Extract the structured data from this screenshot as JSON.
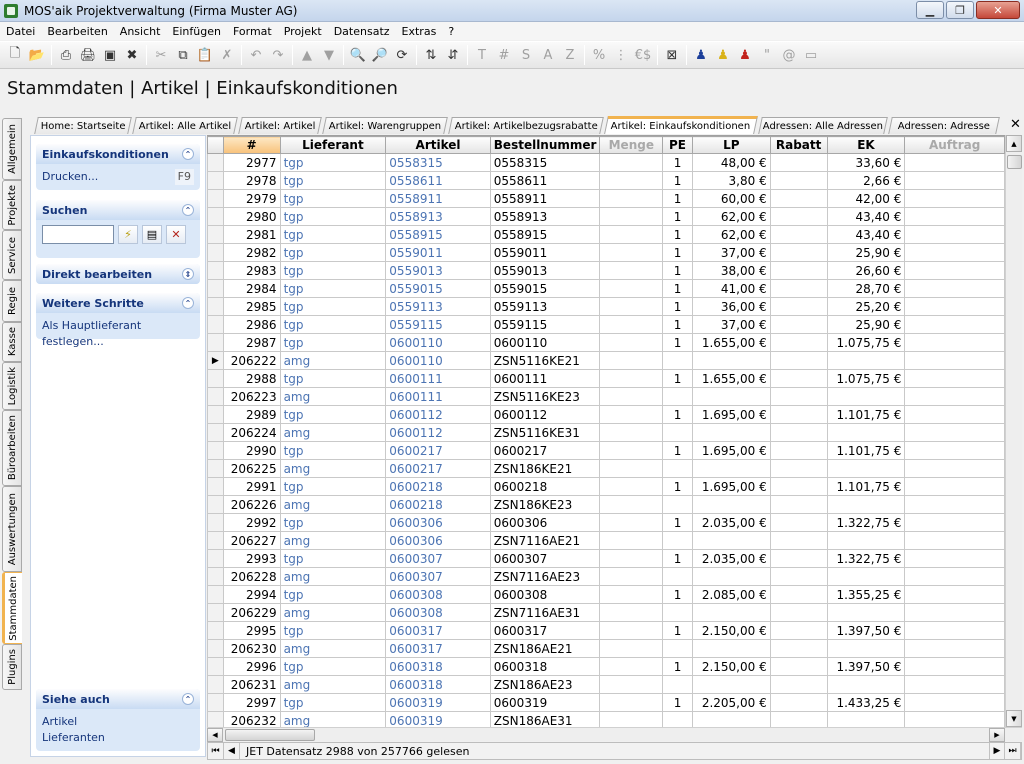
{
  "window": {
    "title": "MOS'aik Projektverwaltung (Firma Muster AG)"
  },
  "menu": [
    "Datei",
    "Bearbeiten",
    "Ansicht",
    "Einfügen",
    "Format",
    "Projekt",
    "Datensatz",
    "Extras",
    "?"
  ],
  "toolbar": {
    "letter_buttons": [
      "T",
      "#",
      "S",
      "A",
      "Z",
      "%",
      "€$",
      "\""
    ]
  },
  "page_title": "Stammdaten | Artikel | Einkaufskonditionen",
  "side_tabs": [
    "Allgemein",
    "Projekte",
    "Service",
    "Regie",
    "Kasse",
    "Logistik",
    "Büroarbeiten",
    "Auswertungen",
    "Stammdaten",
    "Plugins"
  ],
  "active_side_tab": "Stammdaten",
  "tabs": [
    "Home: Startseite",
    "Artikel: Alle Artikel",
    "Artikel: Artikel",
    "Artikel: Warengruppen",
    "Artikel: Artikelbezugsrabatte",
    "Artikel: Einkaufskonditionen",
    "Adressen: Alle Adressen",
    "Adressen: Adresse"
  ],
  "active_tab": "Artikel: Einkaufskonditionen",
  "left_panel": {
    "einkauf": {
      "title": "Einkaufskonditionen",
      "print_label": "Drucken...",
      "print_shortcut": "F9"
    },
    "search": {
      "title": "Suchen",
      "value": ""
    },
    "direct_edit": {
      "title": "Direkt bearbeiten"
    },
    "next_steps": {
      "title": "Weitere Schritte",
      "link": "Als Hauptlieferant festlegen..."
    },
    "see_also": {
      "title": "Siehe auch",
      "links": [
        "Artikel",
        "Lieferanten"
      ]
    }
  },
  "grid": {
    "columns": [
      "#",
      "Lieferant",
      "Artikel",
      "Bestellnummer",
      "Menge",
      "PE",
      "LP",
      "Rabatt",
      "EK",
      "Auftrag"
    ],
    "rows": [
      [
        "2977",
        "tgp",
        "0558315",
        "0558315",
        "",
        "1",
        "48,00 €",
        "",
        "33,60 €",
        ""
      ],
      [
        "2978",
        "tgp",
        "0558611",
        "0558611",
        "",
        "1",
        "3,80 €",
        "",
        "2,66 €",
        ""
      ],
      [
        "2979",
        "tgp",
        "0558911",
        "0558911",
        "",
        "1",
        "60,00 €",
        "",
        "42,00 €",
        ""
      ],
      [
        "2980",
        "tgp",
        "0558913",
        "0558913",
        "",
        "1",
        "62,00 €",
        "",
        "43,40 €",
        ""
      ],
      [
        "2981",
        "tgp",
        "0558915",
        "0558915",
        "",
        "1",
        "62,00 €",
        "",
        "43,40 €",
        ""
      ],
      [
        "2982",
        "tgp",
        "0559011",
        "0559011",
        "",
        "1",
        "37,00 €",
        "",
        "25,90 €",
        ""
      ],
      [
        "2983",
        "tgp",
        "0559013",
        "0559013",
        "",
        "1",
        "38,00 €",
        "",
        "26,60 €",
        ""
      ],
      [
        "2984",
        "tgp",
        "0559015",
        "0559015",
        "",
        "1",
        "41,00 €",
        "",
        "28,70 €",
        ""
      ],
      [
        "2985",
        "tgp",
        "0559113",
        "0559113",
        "",
        "1",
        "36,00 €",
        "",
        "25,20 €",
        ""
      ],
      [
        "2986",
        "tgp",
        "0559115",
        "0559115",
        "",
        "1",
        "37,00 €",
        "",
        "25,90 €",
        ""
      ],
      [
        "2987",
        "tgp",
        "0600110",
        "0600110",
        "",
        "1",
        "1.655,00 €",
        "",
        "1.075,75 €",
        ""
      ],
      [
        "206222",
        "amg",
        "0600110",
        "ZSN5116KE21",
        "",
        "",
        "",
        "",
        "",
        ""
      ],
      [
        "2988",
        "tgp",
        "0600111",
        "0600111",
        "",
        "1",
        "1.655,00 €",
        "",
        "1.075,75 €",
        ""
      ],
      [
        "206223",
        "amg",
        "0600111",
        "ZSN5116KE23",
        "",
        "",
        "",
        "",
        "",
        ""
      ],
      [
        "2989",
        "tgp",
        "0600112",
        "0600112",
        "",
        "1",
        "1.695,00 €",
        "",
        "1.101,75 €",
        ""
      ],
      [
        "206224",
        "amg",
        "0600112",
        "ZSN5116KE31",
        "",
        "",
        "",
        "",
        "",
        ""
      ],
      [
        "2990",
        "tgp",
        "0600217",
        "0600217",
        "",
        "1",
        "1.695,00 €",
        "",
        "1.101,75 €",
        ""
      ],
      [
        "206225",
        "amg",
        "0600217",
        "ZSN186KE21",
        "",
        "",
        "",
        "",
        "",
        ""
      ],
      [
        "2991",
        "tgp",
        "0600218",
        "0600218",
        "",
        "1",
        "1.695,00 €",
        "",
        "1.101,75 €",
        ""
      ],
      [
        "206226",
        "amg",
        "0600218",
        "ZSN186KE23",
        "",
        "",
        "",
        "",
        "",
        ""
      ],
      [
        "2992",
        "tgp",
        "0600306",
        "0600306",
        "",
        "1",
        "2.035,00 €",
        "",
        "1.322,75 €",
        ""
      ],
      [
        "206227",
        "amg",
        "0600306",
        "ZSN7116AE21",
        "",
        "",
        "",
        "",
        "",
        ""
      ],
      [
        "2993",
        "tgp",
        "0600307",
        "0600307",
        "",
        "1",
        "2.035,00 €",
        "",
        "1.322,75 €",
        ""
      ],
      [
        "206228",
        "amg",
        "0600307",
        "ZSN7116AE23",
        "",
        "",
        "",
        "",
        "",
        ""
      ],
      [
        "2994",
        "tgp",
        "0600308",
        "0600308",
        "",
        "1",
        "2.085,00 €",
        "",
        "1.355,25 €",
        ""
      ],
      [
        "206229",
        "amg",
        "0600308",
        "ZSN7116AE31",
        "",
        "",
        "",
        "",
        "",
        ""
      ],
      [
        "2995",
        "tgp",
        "0600317",
        "0600317",
        "",
        "1",
        "2.150,00 €",
        "",
        "1.397,50 €",
        ""
      ],
      [
        "206230",
        "amg",
        "0600317",
        "ZSN186AE21",
        "",
        "",
        "",
        "",
        "",
        ""
      ],
      [
        "2996",
        "tgp",
        "0600318",
        "0600318",
        "",
        "1",
        "2.150,00 €",
        "",
        "1.397,50 €",
        ""
      ],
      [
        "206231",
        "amg",
        "0600318",
        "ZSN186AE23",
        "",
        "",
        "",
        "",
        "",
        ""
      ],
      [
        "2997",
        "tgp",
        "0600319",
        "0600319",
        "",
        "1",
        "2.205,00 €",
        "",
        "1.433,25 €",
        ""
      ],
      [
        "206232",
        "amg",
        "0600319",
        "ZSN186AE31",
        "",
        "",
        "",
        "",
        "",
        ""
      ]
    ],
    "current_row_index": 11
  },
  "status": {
    "text": "JET Datensatz 2988 von 257766 gelesen"
  },
  "colors": {
    "accent_orange": "#f1b34f",
    "link_blue": "#4c74b3",
    "panel_title": "#15357b"
  }
}
